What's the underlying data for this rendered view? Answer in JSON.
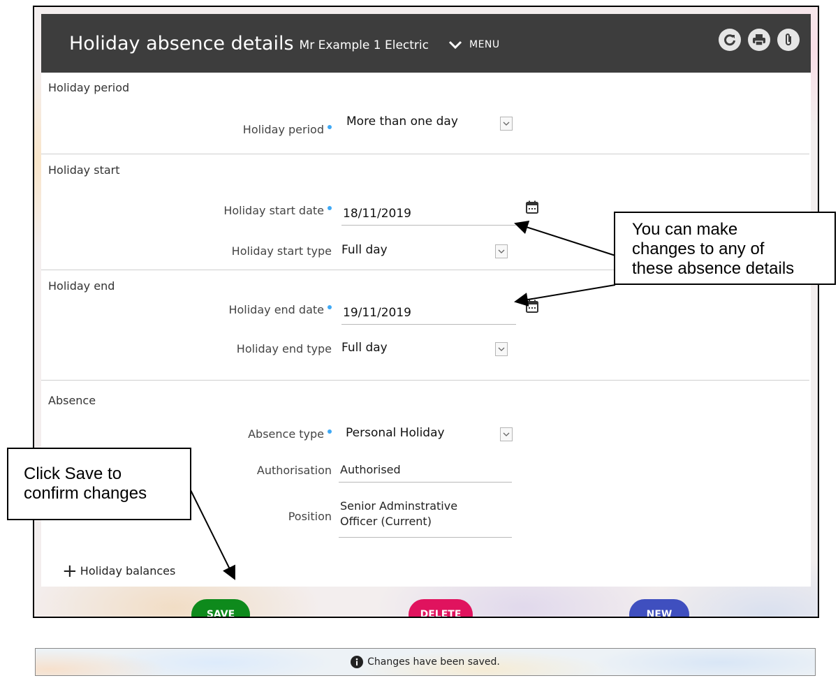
{
  "header": {
    "title": "Holiday absence details",
    "subtitle": "Mr Example 1 Electric",
    "menu_label": "MENU",
    "icons": [
      "refresh-icon",
      "print-icon",
      "attachment-icon"
    ]
  },
  "sections": {
    "holiday_period": {
      "title": "Holiday period",
      "period_label": "Holiday period",
      "period_value": "More than one day"
    },
    "holiday_start": {
      "title": "Holiday start",
      "date_label": "Holiday start date",
      "date_value": "18/11/2019",
      "type_label": "Holiday start type",
      "type_value": "Full day"
    },
    "holiday_end": {
      "title": "Holiday end",
      "date_label": "Holiday end date",
      "date_value": "19/11/2019",
      "type_label": "Holiday end type",
      "type_value": "Full day"
    },
    "absence": {
      "title": "Absence",
      "type_label": "Absence type",
      "type_value": "Personal Holiday",
      "authorisation_label": "Authorisation",
      "authorisation_value": "Authorised",
      "position_label": "Position",
      "position_line1": "Senior Adminstrative",
      "position_line2": "Officer (Current)"
    }
  },
  "holiday_balances_label": "Holiday balances",
  "buttons": {
    "save": "SAVE",
    "delete": "DELETE",
    "new": "NEW"
  },
  "colors": {
    "header_bg": "#3d3d3d",
    "save": "#0e8a1c",
    "delete": "#e0135e",
    "new": "#3f4fbf",
    "required_dot": "#3fa9f5"
  },
  "callouts": {
    "right": [
      "You can make",
      "changes to any of",
      "these absence details"
    ],
    "left": [
      "Click Save to",
      "confirm changes"
    ]
  },
  "toast": {
    "icon": "info-icon",
    "message": "Changes have been saved."
  }
}
